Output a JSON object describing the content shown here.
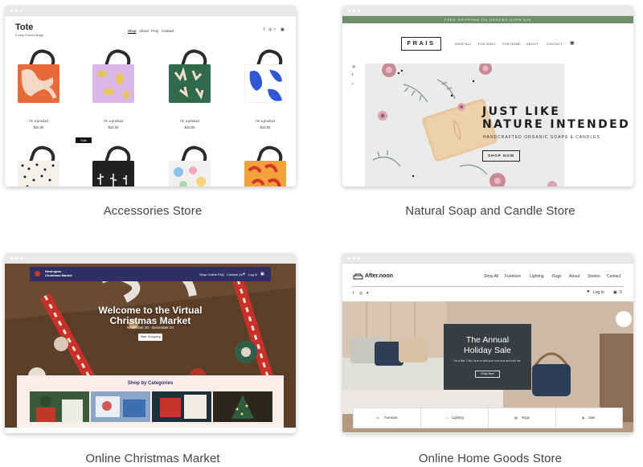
{
  "templates": [
    {
      "caption": "Accessories Store",
      "site": {
        "logo": "Tote",
        "tagline": "Funky Printed Bags",
        "nav": [
          "Shop",
          "About",
          "FAQ",
          "Contact"
        ],
        "products": [
          {
            "name": "I'm a product",
            "price": "$15.00"
          },
          {
            "name": "I'm a product",
            "price": "$15.00"
          },
          {
            "name": "I'm a product",
            "price": "$15.00"
          },
          {
            "name": "I'm a product",
            "price": "$15.00"
          }
        ],
        "badge": "Sale"
      }
    },
    {
      "caption": "Natural Soap and Candle Store",
      "site": {
        "banner": "FREE SHIPPING ON ORDERS OVER $40",
        "logo": "FRAIS",
        "nav": [
          "SHOP ALL",
          "FOR BODY",
          "FOR HOME",
          "ABOUT",
          "CONTACT"
        ],
        "headline_line1": "JUST LIKE",
        "headline_line2": "NATURE INTENDED",
        "subheadline": "HANDCRAFTED ORGANIC SOAPS & CANDLES",
        "cta": "SHOP NOW"
      }
    },
    {
      "caption": "Online Christmas Market",
      "site": {
        "brand_line1": "Newington",
        "brand_line2": "Christmas Market",
        "nav": [
          "Shop Online",
          "FAQ",
          "Contact Us",
          "Log In"
        ],
        "headline_line1": "Welcome to the Virtual",
        "headline_line2": "Christmas Market",
        "dates": "November 30 - December 24",
        "cta": "Start Shopping",
        "section_title": "Shop by Categories"
      }
    },
    {
      "caption": "Online Home Goods Store",
      "site": {
        "logo": "After.noon",
        "nav": [
          "Shop All",
          "Furniture",
          "Lighting",
          "Rugs",
          "About",
          "Stories",
          "Contact"
        ],
        "login": "Log In",
        "cart_count": "0",
        "promo_line1": "The Annual",
        "promo_line2": "Holiday Sale",
        "promo_sub": "I'm a title. Click here to add your own text and edit me.",
        "promo_cta": "Shop Now",
        "categories": [
          "Furniture",
          "Lighting",
          "Rugs",
          "Sale"
        ]
      }
    }
  ],
  "colors": {
    "frais_banner": "#6f8f6c",
    "xmas_nav": "#2f2f66",
    "xmas_panel": "#fbeeea",
    "afternoon_promo": "#3a3d40"
  }
}
